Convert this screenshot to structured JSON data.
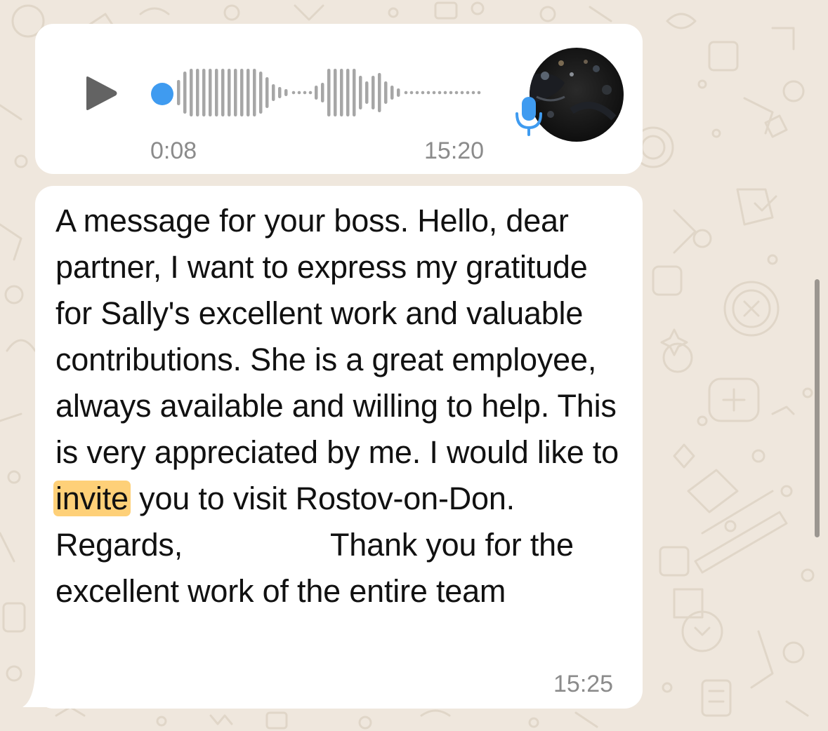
{
  "colors": {
    "wallpaper": "#efe7dd",
    "bubble": "#ffffff",
    "accent_blue": "#3f9bf0",
    "waveform_gray": "#a6a6a6",
    "highlight": "#fed078",
    "meta_text": "#8b8b8b"
  },
  "voice_message": {
    "duration": "0:08",
    "time": "15:20",
    "play_icon": "play-icon",
    "mic_icon": "microphone-icon",
    "progress": 0.0
  },
  "text_message": {
    "before_highlight": "A message for your boss. Hello, dear partner, I want to express my gratitude for Sally's excellent work and valuable contributions. She is a great employee, always available and willing to help. This is very appreciated by me. I would like to ",
    "highlighted_word": "invite",
    "after_highlight_line": " you to visit Rostov-on-Don.",
    "regards": "Regards,",
    "after_regards": "Thank you for the excellent work of the entire team",
    "time": "15:25"
  }
}
